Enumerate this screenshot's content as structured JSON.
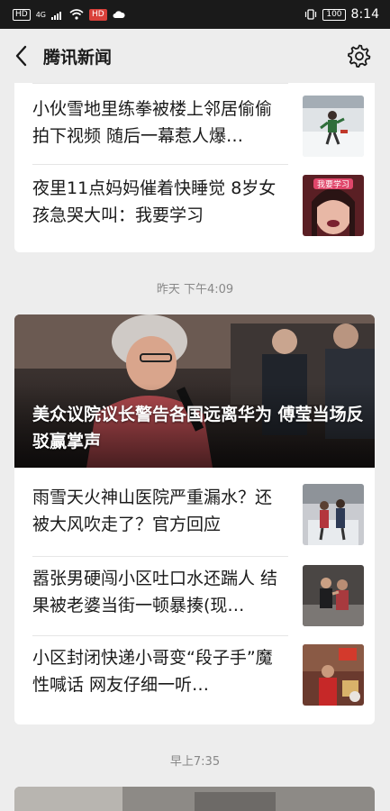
{
  "status_bar": {
    "left_chip_1": "HD",
    "signal_label": "4G",
    "left_chip_2": "HD",
    "battery": "100",
    "time": "8:14"
  },
  "header": {
    "title": "腾讯新闻",
    "back_icon": "chevron-left-icon",
    "settings_icon": "gear-icon"
  },
  "groups": [
    {
      "items": [
        {
          "title": "小伙雪地里练拳被楼上邻居偷偷拍下视频 随后一幕惹人爆…"
        },
        {
          "title": "夜里11点妈妈催着快睡觉 8岁女孩急哭大叫：我要学习",
          "thumb_caption": "我要学习"
        }
      ]
    },
    {
      "time": "昨天 下午4:09",
      "hero_title": "美众议院议长警告各国远离华为 傅莹当场反驳赢掌声",
      "items": [
        {
          "title": "雨雪天火神山医院严重漏水？还被大风吹走了？官方回应"
        },
        {
          "title": "嚣张男硬闯小区吐口水还踹人 结果被老婆当街一顿暴揍(现…"
        },
        {
          "title": "小区封闭快递小哥变“段子手”魔性喊话 网友仔细一听…"
        }
      ]
    },
    {
      "time": "早上7:35"
    }
  ],
  "colors": {
    "background": "#ededed",
    "status_bar": "#1a1a1a",
    "card": "#ffffff",
    "text": "#1a1a1a",
    "muted": "#888888"
  }
}
